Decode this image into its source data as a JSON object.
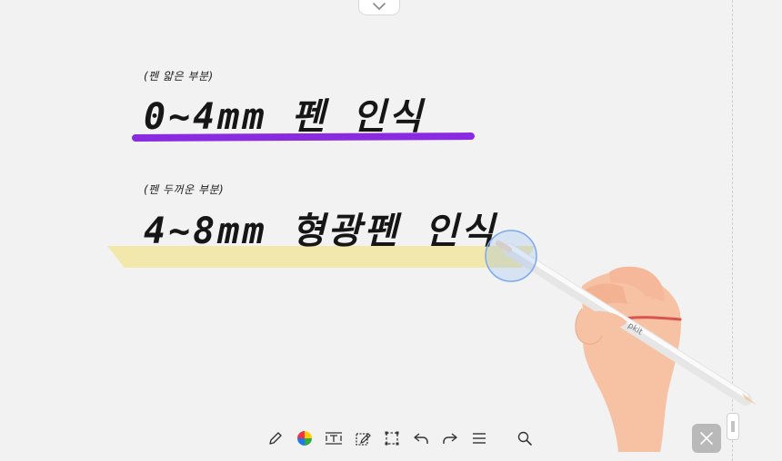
{
  "canvas": {
    "note_thin_caption": "(펜 얇은 부분)",
    "note_thin_title": "0~4mm 펜 인식",
    "note_thick_caption": "(펜 두꺼운 부분)",
    "note_thick_title": "4~8mm 형광펜 인식",
    "stylus_brand": "pkit",
    "pen_color": "#8a2be2",
    "highlighter_color": "#f3e7a3"
  },
  "toolbar": {
    "items": [
      {
        "icon": "pencil-icon"
      },
      {
        "icon": "color-picker-icon"
      },
      {
        "icon": "text-box-icon"
      },
      {
        "icon": "image-edit-icon"
      },
      {
        "icon": "selection-icon"
      },
      {
        "icon": "undo-icon"
      },
      {
        "icon": "redo-icon"
      },
      {
        "icon": "menu-icon"
      },
      {
        "icon": "search-icon"
      }
    ]
  },
  "controls": {
    "top_tab_icon": "chevron-down-icon",
    "close_icon": "close-icon",
    "side_handle_icon": "drag-handle-icon"
  }
}
